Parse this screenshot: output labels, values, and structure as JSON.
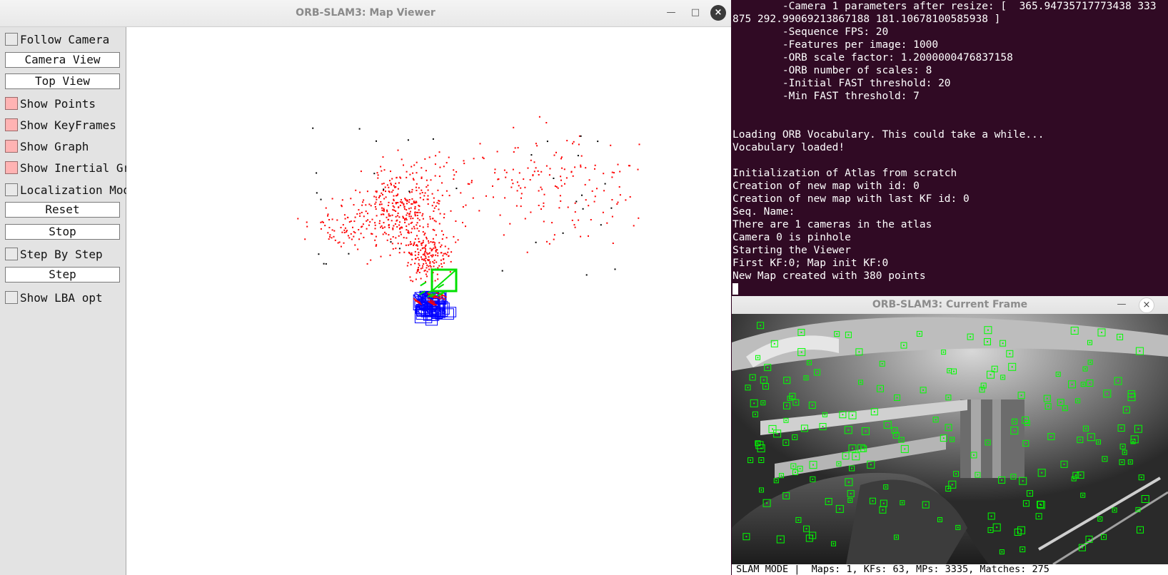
{
  "terminal": {
    "lines": [
      "        -Camera 1 parameters after resize: [  365.94735717773438 333",
      "875 292.99069213867188 181.10678100585938 ]",
      "        -Sequence FPS: 20",
      "        -Features per image: 1000",
      "        -ORB scale factor: 1.2000000476837158",
      "        -ORB number of scales: 8",
      "        -Initial FAST threshold: 20",
      "        -Min FAST threshold: 7",
      "",
      "",
      "Loading ORB Vocabulary. This could take a while...",
      "Vocabulary loaded!",
      "",
      "Initialization of Atlas from scratch",
      "Creation of new map with id: 0",
      "Creation of new map with last KF id: 0",
      "Seq. Name:",
      "There are 1 cameras in the atlas",
      "Camera 0 is pinhole",
      "Starting the Viewer",
      "First KF:0; Map init KF:0",
      "New Map created with 380 points"
    ]
  },
  "map_viewer": {
    "title": "ORB-SLAM3: Map Viewer",
    "controls": {
      "follow_camera": "Follow Camera",
      "camera_view": "Camera View",
      "top_view": "Top View",
      "show_points": "Show Points",
      "show_keyframes": "Show KeyFrames",
      "show_graph": "Show Graph",
      "show_inertial_graph": "Show Inertial Graph",
      "localization_mode": "Localization Mode",
      "reset": "Reset",
      "stop": "Stop",
      "step_by_step": "Step By Step",
      "step": "Step",
      "show_lba_opt": "Show LBA opt"
    },
    "states": {
      "follow_camera": false,
      "show_points": true,
      "show_keyframes": true,
      "show_graph": true,
      "show_inertial_graph": true,
      "localization_mode": false,
      "step_by_step": false,
      "show_lba_opt": false
    },
    "colors": {
      "map_points": "#ff0000",
      "reference_points": "#000000",
      "keyframes": "#0000ff",
      "current_camera": "#00e000",
      "checkbox_on": "#ffb3b3"
    }
  },
  "current_frame": {
    "title": "ORB-SLAM3: Current Frame",
    "status": "SLAM MODE |  Maps: 1, KFs: 63, MPs: 3335, Matches: 275",
    "feature_color": "#00ff00"
  },
  "window_buttons": {
    "minimize": "—",
    "maximize": "□",
    "close": "×"
  }
}
